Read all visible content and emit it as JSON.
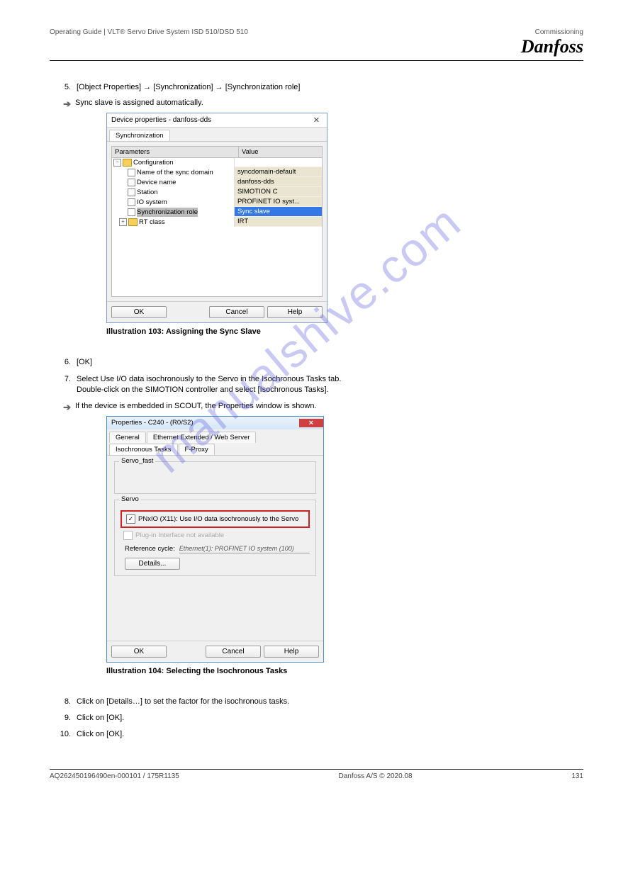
{
  "header": {
    "doc_title": "Operating Guide | VLT® Servo Drive System ISD 510/DSD 510",
    "breadcrumb": "Commissioning",
    "logo": "Danfoss"
  },
  "step1": {
    "num": "5.",
    "text": "[Object Properties] → [Synchronization] → [Synchronization role]"
  },
  "result1": {
    "text": "Sync slave is assigned automatically."
  },
  "dialog1": {
    "title": "Device properties - danfoss-dds",
    "tab": "Synchronization",
    "columns": {
      "param": "Parameters",
      "value": "Value"
    },
    "tree": {
      "root": "Configuration",
      "rows": [
        {
          "label": "Name of the sync domain",
          "value": "syncdomain-default"
        },
        {
          "label": "Device name",
          "value": "danfoss-dds"
        },
        {
          "label": "Station",
          "value": "SIMOTION C"
        },
        {
          "label": "IO system",
          "value": "PROFINET IO syst..."
        },
        {
          "label": "Synchronization role",
          "value": "Sync slave",
          "selected": true
        },
        {
          "label": "RT class",
          "value": "IRT",
          "folder": true
        }
      ]
    },
    "buttons": {
      "ok": "OK",
      "cancel": "Cancel",
      "help": "Help"
    }
  },
  "caption1": "Illustration 103: Assigning the Sync Slave",
  "step2": {
    "num": "6.",
    "text": "[OK]"
  },
  "after2": {
    "num": "7.",
    "line1": "Select Use I/O data isochronously to the Servo in the Isochronous Tasks tab.",
    "line2": "Double-click on the SIMOTION controller and select [Isochronous Tasks]."
  },
  "result2": {
    "text": "If the device is embedded in SCOUT, the Properties window is shown."
  },
  "dialog2": {
    "title": "Properties - C240 - (R0/S2)",
    "tabs": {
      "general": "General",
      "eth": "Ethernet Extended / Web Server",
      "iso": "Isochronous Tasks",
      "fp": "F-Proxy"
    },
    "group_fast": "Servo_fast",
    "group_servo": "Servo",
    "chk1": "PNxIO (X11): Use I/O data isochronously to the Servo",
    "chk2": "Plug-in Interface not available",
    "ref_label": "Reference cycle:",
    "ref_value": "Ethernet(1): PROFINET IO system (100)",
    "details": "Details...",
    "buttons": {
      "ok": "OK",
      "cancel": "Cancel",
      "help": "Help"
    }
  },
  "caption2": "Illustration 104: Selecting the Isochronous Tasks",
  "step3a": {
    "num": "8.",
    "text": "Click on [Details…] to set the factor for the isochronous tasks."
  },
  "step3b": {
    "num": "9.",
    "text": "Click on [OK]."
  },
  "step3c": {
    "num": "10.",
    "text": "Click on [OK]."
  },
  "watermark": "manualshive.com",
  "footer": {
    "left": "AQ262450196490en-000101 / 175R1135",
    "mid": "Danfoss A/S © 2020.08",
    "right": "131"
  }
}
